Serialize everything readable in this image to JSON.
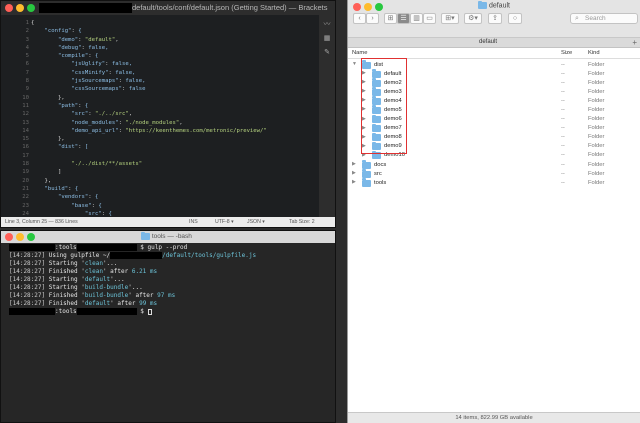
{
  "editor": {
    "title": "default/tools/conf/default.json (Getting Started) — Brackets",
    "line_numbers": [
      "1",
      "2",
      "3",
      "4",
      "5",
      "6",
      "7",
      "8",
      "9",
      "10",
      "11",
      "12",
      "13",
      "14",
      "15",
      "16",
      "17",
      "18",
      "19",
      "20",
      "21",
      "22",
      "23",
      "24",
      "25"
    ],
    "code": [
      "{",
      "    \"config\": {",
      "        \"demo\": \"default\",",
      "        \"debug\": false,",
      "        \"compile\": {",
      "            \"jsUglify\": false,",
      "            \"cssMinify\": false,",
      "            \"jsSourcemaps\": false,",
      "            \"cssSourcemaps\": false",
      "        },",
      "        \"path\": {",
      "            \"src\": \"./../src\",",
      "            \"node_modules\": \"./node_modules\",",
      "            \"demo_api_url\": \"https://keenthemes.com/metronic/preview/\"",
      "        },",
      "        \"dist\": [",
      "",
      "            \"./../dist/**/assets\"",
      "        ]",
      "    },",
      "    \"build\": {",
      "        \"vendors\": {",
      "            \"base\": {",
      "                \"src\": {",
      "                    \"mandatory\": {",
      "                        \"jquery\": {",
      "                            \"scripts\": ["
    ],
    "status": {
      "position": "Line 3, Column 25 — 836 Lines",
      "mode": "INS",
      "encoding": "UTF-8 ▾",
      "language": "JSON ▾",
      "tab_size": "Tab Size: 2"
    }
  },
  "terminal": {
    "title": "tools — -bash",
    "prompt_suffix": ":tools",
    "command": "$ gulp --prod",
    "lines": [
      {
        "time": "[14:28:27]",
        "text": " Using gulpfile ~/",
        "tail": "/default/tools/gulpfile.js",
        "hl": ""
      },
      {
        "time": "[14:28:27]",
        "text": " Starting '",
        "hl": "clean",
        "tail": "'..."
      },
      {
        "time": "[14:28:27]",
        "text": " Finished '",
        "hl": "clean",
        "tail": "' after ",
        "ms": "6.21 ms"
      },
      {
        "time": "[14:28:27]",
        "text": " Starting '",
        "hl": "default",
        "tail": "'..."
      },
      {
        "time": "[14:28:27]",
        "text": " Starting '",
        "hl": "build-bundle",
        "tail": "'..."
      },
      {
        "time": "[14:28:27]",
        "text": " Finished '",
        "hl": "build-bundle",
        "tail": "' after ",
        "ms": "97 ms"
      },
      {
        "time": "[14:28:27]",
        "text": " Finished '",
        "hl": "default",
        "tail": "' after ",
        "ms": "99 ms"
      }
    ],
    "final_prompt": "$"
  },
  "finder": {
    "title": "default",
    "tab": "default",
    "search_placeholder": "Search",
    "columns": {
      "name": "Name",
      "size": "Size",
      "kind": "Kind"
    },
    "rows": [
      {
        "name": "dist",
        "size": "--",
        "kind": "Folder",
        "level": 0,
        "open": true
      },
      {
        "name": "default",
        "size": "--",
        "kind": "Folder",
        "level": 1,
        "open": false
      },
      {
        "name": "demo2",
        "size": "--",
        "kind": "Folder",
        "level": 1,
        "open": false
      },
      {
        "name": "demo3",
        "size": "--",
        "kind": "Folder",
        "level": 1,
        "open": false
      },
      {
        "name": "demo4",
        "size": "--",
        "kind": "Folder",
        "level": 1,
        "open": false
      },
      {
        "name": "demo5",
        "size": "--",
        "kind": "Folder",
        "level": 1,
        "open": false
      },
      {
        "name": "demo6",
        "size": "--",
        "kind": "Folder",
        "level": 1,
        "open": false
      },
      {
        "name": "demo7",
        "size": "--",
        "kind": "Folder",
        "level": 1,
        "open": false
      },
      {
        "name": "demo8",
        "size": "--",
        "kind": "Folder",
        "level": 1,
        "open": false
      },
      {
        "name": "demo9",
        "size": "--",
        "kind": "Folder",
        "level": 1,
        "open": false
      },
      {
        "name": "demo10",
        "size": "--",
        "kind": "Folder",
        "level": 1,
        "open": false
      },
      {
        "name": "docs",
        "size": "--",
        "kind": "Folder",
        "level": 0,
        "open": false
      },
      {
        "name": "src",
        "size": "--",
        "kind": "Folder",
        "level": 0,
        "open": false
      },
      {
        "name": "tools",
        "size": "--",
        "kind": "Folder",
        "level": 0,
        "open": false
      }
    ],
    "status": "14 items, 822.99 GB available",
    "highlight_color": "#e03131"
  }
}
